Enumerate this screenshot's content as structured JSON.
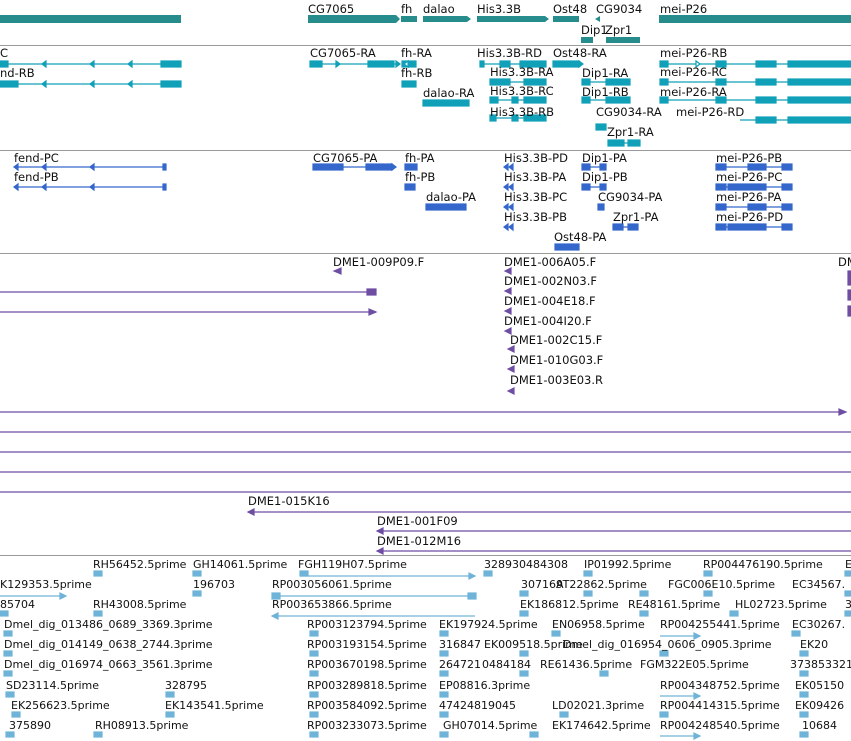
{
  "colors": {
    "gene": "#268c8c",
    "transcript": "#10a0b8",
    "cds": "#3467cc",
    "probe": "#6e4ea3",
    "est": "#6fb3d8",
    "divider": "#9a9a9a"
  },
  "gene_track": {
    "labels": [
      "CG7065",
      "fh",
      "dalao",
      "His3.3B",
      "Ost48",
      "CG9034",
      "mei-P26",
      "Dip1",
      "Zpr1"
    ]
  },
  "mrna_track": {
    "labels": [
      "C",
      "nd-RB",
      "CG7065-RA",
      "fh-RA",
      "fh-RB",
      "dalao-RA",
      "His3.3B-RD",
      "His3.3B-RA",
      "His3.3B-RC",
      "His3.3B-RB",
      "Ost48-RA",
      "Dip1-RA",
      "Dip1-RB",
      "CG9034-RA",
      "Zpr1-RA",
      "mei-P26-RB",
      "mei-P26-RC",
      "mei-P26-RA",
      "mei-P26-RD"
    ]
  },
  "protein_track": {
    "labels": [
      "fend-PC",
      "fend-PB",
      "CG7065-PA",
      "fh-PA",
      "fh-PB",
      "dalao-PA",
      "His3.3B-PD",
      "His3.3B-PA",
      "His3.3B-PC",
      "His3.3B-PB",
      "Dip1-PA",
      "Dip1-PB",
      "CG9034-PA",
      "Zpr1-PA",
      "Ost48-PA",
      "mei-P26-PB",
      "mei-P26-PC",
      "mei-P26-PA",
      "mei-P26-PD"
    ]
  },
  "probe_track": {
    "labels": [
      "DME1-009P09.F",
      "DME1-006A05.F",
      "DME1-002N03.F",
      "DME1-004E18.F",
      "DME1-004I20.F",
      "DME1-002C15.F",
      "DME1-010G03.F",
      "DME1-003E03.R",
      "DM"
    ]
  },
  "clone_track": {
    "labels": [
      "DME1-015K16",
      "DME1-001F09",
      "DME1-012M16"
    ]
  },
  "est_track": {
    "labels": [
      "RH56452.5prime",
      "GH14061.5prime",
      "FGH119H07.5prime",
      "328930484308",
      "IP01992.5prime",
      "RP004476190.5prime",
      "E",
      "K129353.5prime",
      "196703",
      "RP003056061.5prime",
      "307169",
      "AT22862.5prime",
      "FGC006E10.5prime",
      "EC34567.",
      "85704",
      "RH43008.5prime",
      "RP003653866.5prime",
      "EK186812.5prime",
      "RE48161.5prime",
      "HL02723.5prime",
      "3",
      "Dmel_dig_013486_0689_3369.3prime",
      "RP003123794.5prime",
      "EK197924.5prime",
      "EN06958.5prime",
      "RP004255441.5prime",
      "EC30267.",
      "Dmel_dig_014149_0638_2744.3prime",
      "RP003193154.5prime",
      "316847",
      "EK009518.5prime",
      "Dmel_dig_016954_0606_0905.3prime",
      "EK20",
      "Dmel_dig_016974_0663_3561.3prime",
      "RP003670198.5prime",
      "264721",
      "0484184",
      "RE61436.5prime",
      "FGM322E05.5prime",
      "373853321",
      "SD23114.5prime",
      "328795",
      "RP003289818.5prime",
      "EP08816.3prime",
      "RP004348752.5prime",
      "EK05150",
      "EK256623.5prime",
      "EK143541.5prime",
      "RP003584092.5prime",
      "47424819045",
      "LD02021.3prime",
      "RP004414315.5prime",
      "EK09426",
      "375890",
      "RH08913.5prime",
      "RP003233073.5prime",
      "GH07014.5prime",
      "EK174642.5prime",
      "RP004248540.5prime",
      "10684"
    ]
  }
}
